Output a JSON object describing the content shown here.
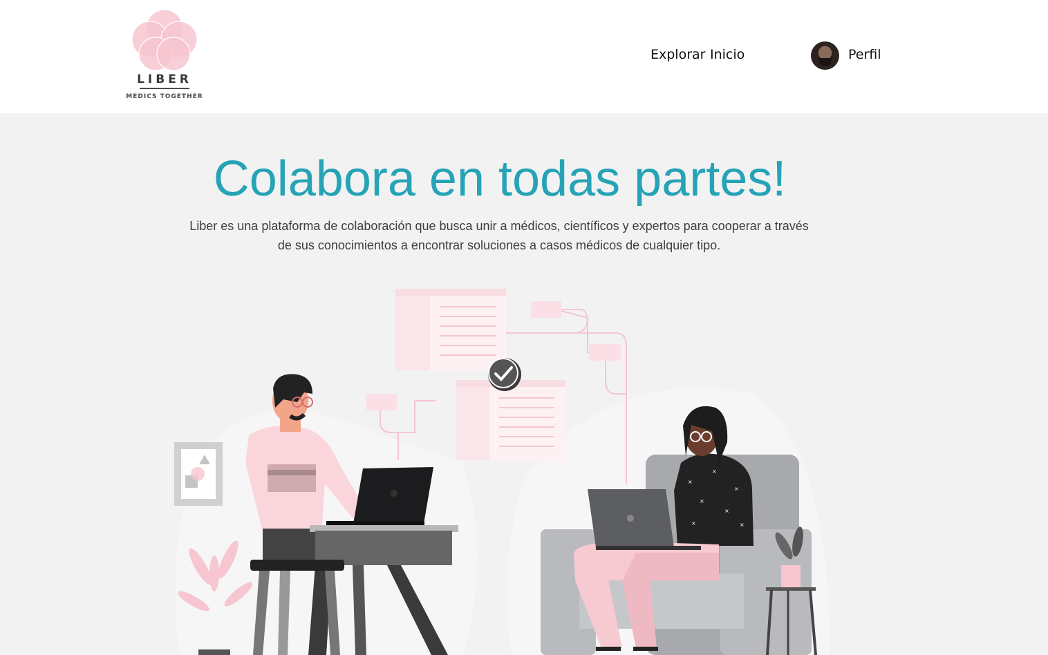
{
  "brand": {
    "name": "LIBER",
    "tagline": "MEDICS TOGETHER"
  },
  "nav": {
    "links": [
      {
        "label": "Explorar"
      },
      {
        "label": "Inicio"
      }
    ],
    "profile_label": "Perfil"
  },
  "hero": {
    "title": "Colabora en todas partes!",
    "subtitle": "Liber es una plataforma de colaboración que busca unir a médicos, científicos y expertos para cooperar a través de sus conocimientos a encontrar soluciones a casos médicos de cualquier tipo."
  },
  "colors": {
    "accent": "#26a3b6",
    "logo_pink": "#f7c6d0",
    "background": "#f2f2f2"
  },
  "icons": [
    "flower-logo-icon",
    "avatar",
    "check-circle-icon"
  ]
}
